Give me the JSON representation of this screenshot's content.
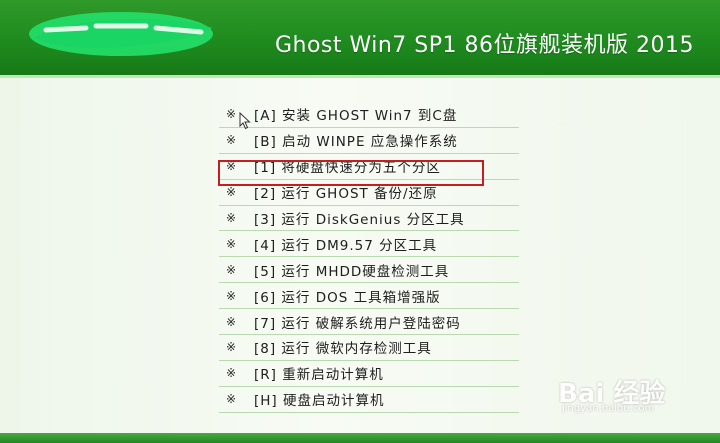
{
  "header": {
    "logo_icon": "logo-icon",
    "title": "Ghost Win7 SP1 86位旗舰装机版 2015"
  },
  "menu": {
    "bullet": "※",
    "items": [
      {
        "label": "[A] 安装 GHOST Win7 到C盘"
      },
      {
        "label": "[B] 启动 WINPE 应急操作系统"
      },
      {
        "label": "[1] 将硬盘快速分为五个分区"
      },
      {
        "label": "[2] 运行 GHOST 备份/还原"
      },
      {
        "label": "[3] 运行 DiskGenius 分区工具"
      },
      {
        "label": "[4] 运行 DM9.57 分区工具",
        "highlighted": true
      },
      {
        "label": "[5] 运行 MHDD硬盘检测工具"
      },
      {
        "label": "[6] 运行 DOS 工具箱增强版"
      },
      {
        "label": "[7] 运行 破解系统用户登陆密码"
      },
      {
        "label": "[8] 运行 微软内存检测工具"
      },
      {
        "label": "[R] 重新启动计算机"
      },
      {
        "label": "[H] 硬盘启动计算机"
      }
    ]
  },
  "watermark": {
    "brand": "Bai 经验",
    "url": "jingyan.baidu.com"
  },
  "colors": {
    "header_green": "#1f8b1f",
    "highlight_red": "#c61e1e",
    "background": "#f3f8ef"
  }
}
